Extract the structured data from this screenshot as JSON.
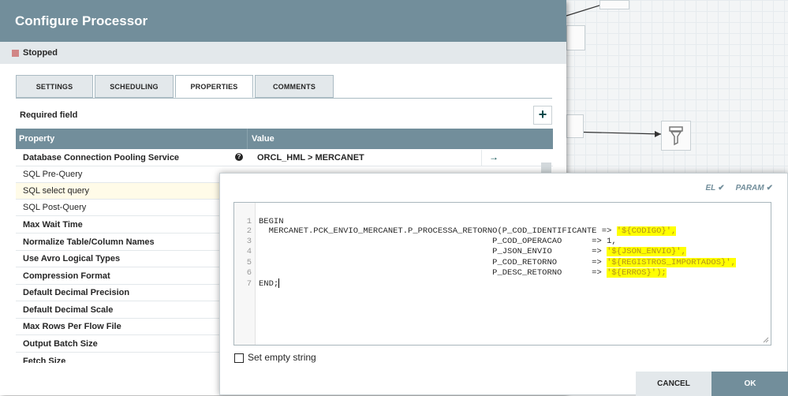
{
  "dialog": {
    "title": "Configure Processor",
    "status": "Stopped",
    "tabs": [
      {
        "label": "SETTINGS",
        "active": false
      },
      {
        "label": "SCHEDULING",
        "active": false
      },
      {
        "label": "PROPERTIES",
        "active": true
      },
      {
        "label": "COMMENTS",
        "active": false
      }
    ],
    "required_field_label": "Required field",
    "add_property_label": "+"
  },
  "properties_table": {
    "headers": {
      "property": "Property",
      "value": "Value"
    },
    "rows": [
      {
        "name": "Database Connection Pooling Service",
        "bold": true,
        "value": "ORCL_HML > MERCANET",
        "help_icon": "question-circle-icon",
        "goto_icon": "arrow-right-icon",
        "goto_glyph": "→"
      },
      {
        "name": "SQL Pre-Query",
        "bold": false
      },
      {
        "name": "SQL select query",
        "bold": false,
        "selected": true
      },
      {
        "name": "SQL Post-Query",
        "bold": false
      },
      {
        "name": "Max Wait Time",
        "bold": true
      },
      {
        "name": "Normalize Table/Column Names",
        "bold": true
      },
      {
        "name": "Use Avro Logical Types",
        "bold": true
      },
      {
        "name": "Compression Format",
        "bold": true
      },
      {
        "name": "Default Decimal Precision",
        "bold": true
      },
      {
        "name": "Default Decimal Scale",
        "bold": true
      },
      {
        "name": "Max Rows Per Flow File",
        "bold": true
      },
      {
        "name": "Output Batch Size",
        "bold": true
      },
      {
        "name": "Fetch Size",
        "bold": true
      }
    ]
  },
  "editor": {
    "flags": {
      "el": "EL",
      "param": "PARAM",
      "check": "✔"
    },
    "lines": [
      {
        "n": "1",
        "text": "BEGIN"
      },
      {
        "n": "2",
        "prefix": "  MERCANET.PCK_ENVIO_MERCANET.P_PROCESSA_RETORNO(P_COD_IDENTIFICANTE => ",
        "expr": "'${CODIGO}',"
      },
      {
        "n": "3",
        "text": "                                               P_COD_OPERACAO      => 1,"
      },
      {
        "n": "4",
        "prefix": "                                               P_JSON_ENVIO        => ",
        "expr": "'${JSON_ENVIO}',"
      },
      {
        "n": "5",
        "prefix": "                                               P_COD_RETORNO       => ",
        "expr": "'${REGISTROS_IMPORTADOS}',"
      },
      {
        "n": "6",
        "prefix": "                                               P_DESC_RETORNO      => ",
        "expr": "'${ERROS}');"
      },
      {
        "n": "7",
        "text": "END;"
      }
    ],
    "set_empty_string_label": "Set empty string",
    "cancel_label": "CANCEL",
    "ok_label": "OK"
  },
  "colors": {
    "header": "#728e9b",
    "highlight": "#ffff00",
    "stopped": "#d18686"
  }
}
